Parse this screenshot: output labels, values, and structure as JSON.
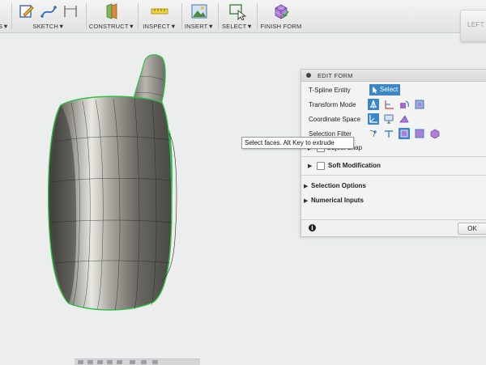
{
  "toolbar": {
    "groups": [
      {
        "label": "S",
        "caret": "▼"
      },
      {
        "label": "SKETCH",
        "caret": "▼"
      },
      {
        "label": "CONSTRUCT",
        "caret": "▼"
      },
      {
        "label": "INSPECT",
        "caret": "▼"
      },
      {
        "label": "INSERT",
        "caret": "▼"
      },
      {
        "label": "SELECT",
        "caret": "▼"
      },
      {
        "label": "FINISH FORM",
        "caret": ""
      }
    ]
  },
  "viewcube": {
    "face": "LEFT"
  },
  "panel": {
    "title": "EDIT FORM",
    "rows": [
      {
        "label": "T-Spline Entity"
      },
      {
        "label": "Transform Mode"
      },
      {
        "label": "Coordinate Space"
      },
      {
        "label": "Selection Filter"
      }
    ],
    "select_button": "Select",
    "object_snap": "Object Snap",
    "soft_modification": "Soft Modification",
    "selection_options": "Selection Options",
    "numerical_inputs": "Numerical Inputs",
    "info": "i",
    "ok": "OK"
  },
  "tooltip": "Select faces. Alt Key to extrude",
  "colors": {
    "accent": "#3a86c8",
    "model": "#9c9a92",
    "edge_highlight": "#35d24b",
    "background": "#eceded"
  }
}
